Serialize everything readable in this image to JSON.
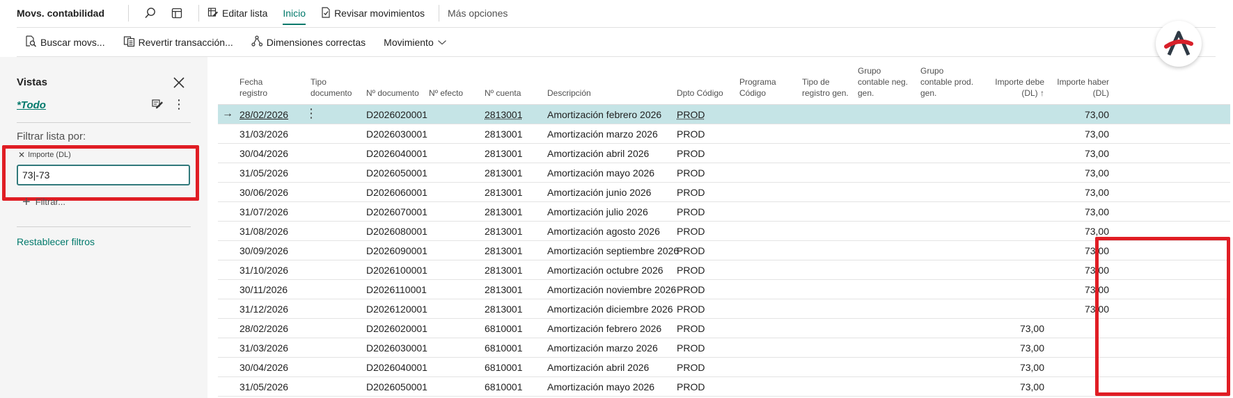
{
  "topbar": {
    "title": "Movs. contabilidad",
    "edit_list": "Editar lista",
    "home": "Inicio",
    "review_entries": "Revisar movimientos",
    "more_options": "Más opciones"
  },
  "actionbar": {
    "find_entries": "Buscar movs...",
    "reverse_transaction": "Revertir transacción...",
    "correct_dimensions": "Dimensiones correctas",
    "entry": "Movimiento"
  },
  "pane": {
    "title": "Vistas",
    "view_all": "*Todo",
    "filter_heading": "Filtrar lista por:",
    "filter_field": "Importe (DL)",
    "filter_value": "73|-73",
    "add_filter": "Filtrar...",
    "reset_filters": "Restablecer filtros"
  },
  "grid": {
    "columns": [
      {
        "l1": "Fecha",
        "l2": "registro",
        "l3": ""
      },
      {
        "l1": "Tipo",
        "l2": "documento",
        "l3": ""
      },
      {
        "l1": "",
        "l2": "Nº documento",
        "l3": ""
      },
      {
        "l1": "",
        "l2": "Nº efecto",
        "l3": ""
      },
      {
        "l1": "",
        "l2": "Nº cuenta",
        "l3": ""
      },
      {
        "l1": "",
        "l2": "Descripción",
        "l3": ""
      },
      {
        "l1": "",
        "l2": "Dpto Código",
        "l3": ""
      },
      {
        "l1": "Programa",
        "l2": "Código",
        "l3": ""
      },
      {
        "l1": "Tipo de",
        "l2": "registro gen.",
        "l3": ""
      },
      {
        "l1": "Grupo",
        "l2": "contable neg.",
        "l3": "gen."
      },
      {
        "l1": "Grupo",
        "l2": "contable prod.",
        "l3": "gen."
      },
      {
        "l1": "Importe debe",
        "l2": "(DL) ↑",
        "l3": ""
      },
      {
        "l1": "Importe haber",
        "l2": "(DL)",
        "l3": ""
      }
    ],
    "rows": [
      {
        "date": "28/02/2026",
        "doc": "D2026020001",
        "account": "2813001",
        "desc": "Amortización febrero 2026",
        "dept": "PROD",
        "debit": "",
        "credit": "73,00"
      },
      {
        "date": "31/03/2026",
        "doc": "D2026030001",
        "account": "2813001",
        "desc": "Amortización marzo 2026",
        "dept": "PROD",
        "debit": "",
        "credit": "73,00"
      },
      {
        "date": "30/04/2026",
        "doc": "D2026040001",
        "account": "2813001",
        "desc": "Amortización abril 2026",
        "dept": "PROD",
        "debit": "",
        "credit": "73,00"
      },
      {
        "date": "31/05/2026",
        "doc": "D2026050001",
        "account": "2813001",
        "desc": "Amortización mayo 2026",
        "dept": "PROD",
        "debit": "",
        "credit": "73,00"
      },
      {
        "date": "30/06/2026",
        "doc": "D2026060001",
        "account": "2813001",
        "desc": "Amortización junio 2026",
        "dept": "PROD",
        "debit": "",
        "credit": "73,00"
      },
      {
        "date": "31/07/2026",
        "doc": "D2026070001",
        "account": "2813001",
        "desc": "Amortización julio 2026",
        "dept": "PROD",
        "debit": "",
        "credit": "73,00"
      },
      {
        "date": "31/08/2026",
        "doc": "D2026080001",
        "account": "2813001",
        "desc": "Amortización agosto 2026",
        "dept": "PROD",
        "debit": "",
        "credit": "73,00"
      },
      {
        "date": "30/09/2026",
        "doc": "D2026090001",
        "account": "2813001",
        "desc": "Amortización septiembre 2026",
        "dept": "PROD",
        "debit": "",
        "credit": "73,00"
      },
      {
        "date": "31/10/2026",
        "doc": "D2026100001",
        "account": "2813001",
        "desc": "Amortización octubre 2026",
        "dept": "PROD",
        "debit": "",
        "credit": "73,00"
      },
      {
        "date": "30/11/2026",
        "doc": "D2026110001",
        "account": "2813001",
        "desc": "Amortización noviembre 2026",
        "dept": "PROD",
        "debit": "",
        "credit": "73,00"
      },
      {
        "date": "31/12/2026",
        "doc": "D2026120001",
        "account": "2813001",
        "desc": "Amortización diciembre 2026",
        "dept": "PROD",
        "debit": "",
        "credit": "73,00"
      },
      {
        "date": "28/02/2026",
        "doc": "D2026020001",
        "account": "6810001",
        "desc": "Amortización febrero 2026",
        "dept": "PROD",
        "debit": "73,00",
        "credit": ""
      },
      {
        "date": "31/03/2026",
        "doc": "D2026030001",
        "account": "6810001",
        "desc": "Amortización marzo 2026",
        "dept": "PROD",
        "debit": "73,00",
        "credit": ""
      },
      {
        "date": "30/04/2026",
        "doc": "D2026040001",
        "account": "6810001",
        "desc": "Amortización abril 2026",
        "dept": "PROD",
        "debit": "73,00",
        "credit": ""
      },
      {
        "date": "31/05/2026",
        "doc": "D2026050001",
        "account": "6810001",
        "desc": "Amortización mayo 2026",
        "dept": "PROD",
        "debit": "73,00",
        "credit": ""
      }
    ]
  },
  "colors": {
    "accent": "#00796b",
    "selected_row": "#c5e4e6",
    "highlight_box": "#e01d24",
    "logo_red": "#d8202a",
    "logo_dark": "#2f3a45"
  }
}
